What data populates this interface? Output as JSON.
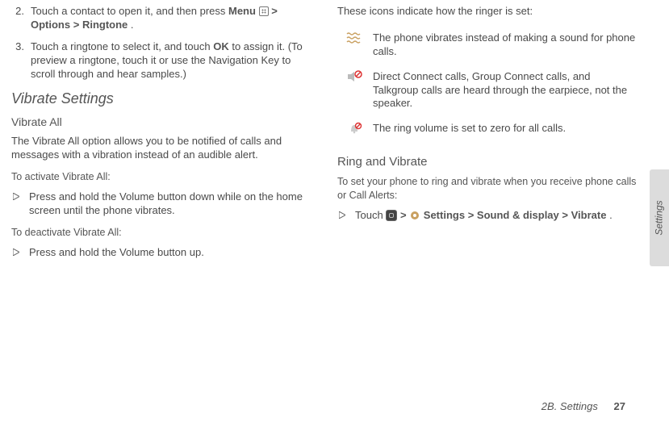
{
  "left": {
    "step2": {
      "num": "2.",
      "t1": "Touch a contact to open it, and then press ",
      "menu": "Menu",
      "arrow1": " > ",
      "opt": "Options",
      "arrow2": " > ",
      "ring": "Ringtone",
      "dot": "."
    },
    "step3": {
      "num": "3.",
      "t1": "Touch a ringtone to select it, and touch ",
      "ok": "OK",
      "t2": " to assign it. (To preview a ringtone, touch it or use the Navigation Key to scroll through and hear samples.)"
    },
    "sectionVibrate": "Vibrate Settings",
    "subVibrateAll": "Vibrate All",
    "vibrateBody": "The Vibrate All option allows you to be notified of calls and messages with a vibration instead of an audible alert.",
    "activateLead": "To activate Vibrate All:",
    "activateItem": "Press and hold the Volume button down while on the home screen until the phone vibrates.",
    "deactivateLead": "To deactivate Vibrate All:",
    "deactivateItem": "Press and hold the Volume button up."
  },
  "right": {
    "intro": "These icons indicate how the ringer is set:",
    "row1": "The phone vibrates instead of making a sound for phone calls.",
    "row2": "Direct Connect calls, Group Connect calls, and Talkgroup calls are heard through the earpiece, not the speaker.",
    "row3": "The ring volume is set to zero for all calls.",
    "subRingVib": "Ring and Vibrate",
    "rvLead": "To set your phone to ring and vibrate when you receive phone calls or Call Alerts:",
    "rvItem": {
      "t1": "Touch ",
      "arrow1": " > ",
      "settings": "Settings",
      "arrow2": " > ",
      "sound": "Sound & display",
      "arrow3": " > ",
      "vibrate": "Vibrate",
      "dot": "."
    }
  },
  "footer": {
    "section": "2B. Settings",
    "page": "27"
  },
  "tab": "Settings"
}
